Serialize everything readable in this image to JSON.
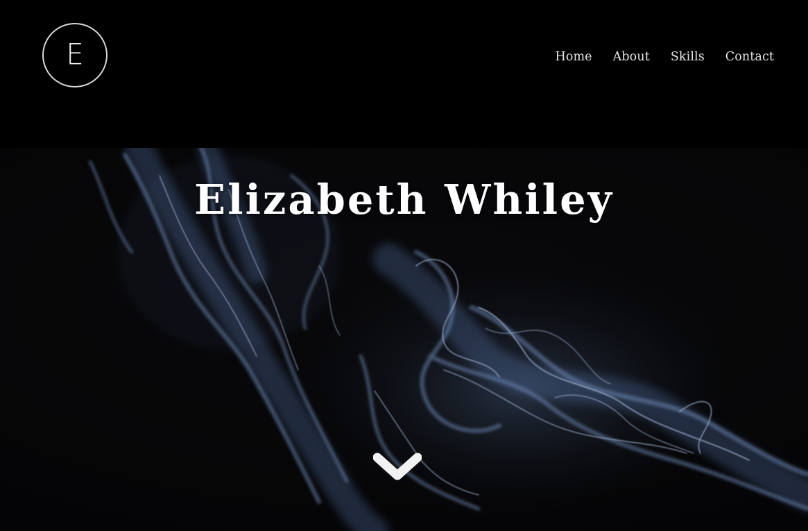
{
  "header": {
    "logo_letter": "E",
    "nav": [
      {
        "label": "Home"
      },
      {
        "label": "About"
      },
      {
        "label": "Skills"
      },
      {
        "label": "Contact"
      }
    ]
  },
  "hero": {
    "title": "Elizabeth Whiley",
    "scroll_icon": "chevron-down-icon",
    "smoke_color": "#8fb0e0"
  },
  "colors": {
    "background": "#000000",
    "text": "#ffffff",
    "nav_text": "#e6e6e6"
  }
}
